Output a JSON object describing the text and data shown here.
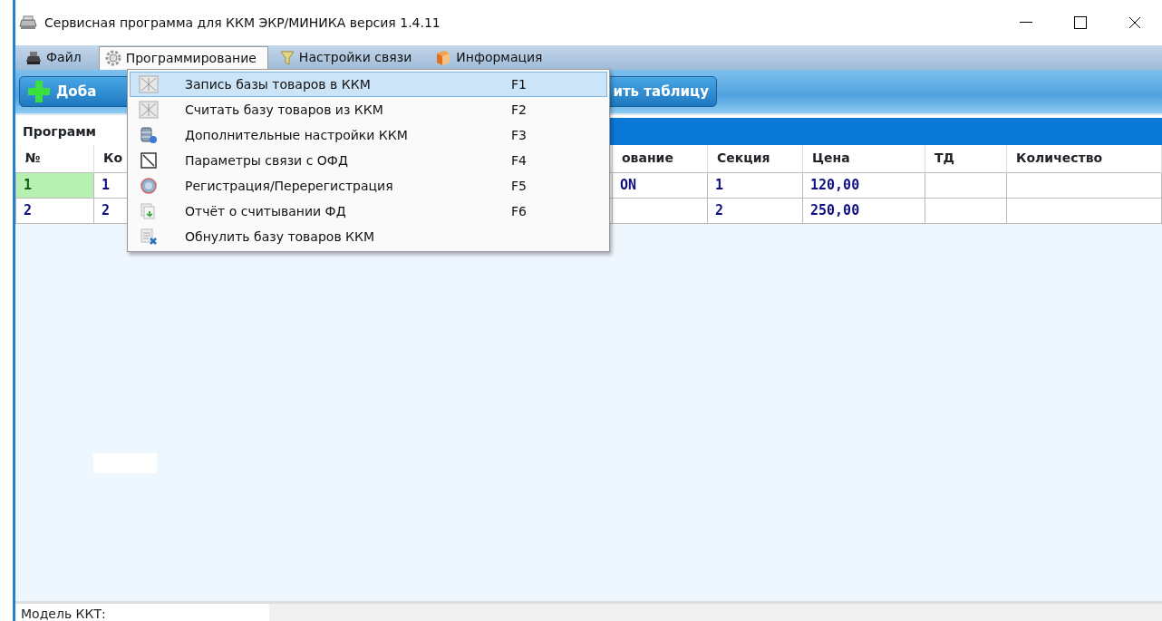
{
  "window": {
    "title": "Сервисная программа для ККМ ЭКР/МИНИКА версия 1.4.11"
  },
  "menu": [
    {
      "label": "Файл",
      "selected": false
    },
    {
      "label": "Программирование",
      "selected": true
    },
    {
      "label": "Настройки связи",
      "selected": false
    },
    {
      "label": "Информация",
      "selected": false
    }
  ],
  "dropdown": {
    "items": [
      {
        "label": "Запись базы товаров в ККМ",
        "shortcut": "F1",
        "selected": true
      },
      {
        "label": "Считать базу товаров из ККМ",
        "shortcut": "F2",
        "selected": false
      },
      {
        "label": "Дополнительные настройки ККМ",
        "shortcut": "F3",
        "selected": false
      },
      {
        "label": "Параметры связи с ОФД",
        "shortcut": "F4",
        "selected": false
      },
      {
        "label": "Регистрация/Перерегистрация",
        "shortcut": "F5",
        "selected": false
      },
      {
        "label": "Отчёт о считывании ФД",
        "shortcut": "F6",
        "selected": false
      },
      {
        "label": "Обнулить базу товаров ККМ",
        "selected": false
      }
    ]
  },
  "toolbar": {
    "buttons": [
      {
        "label": "Доба",
        "kind": "add"
      },
      {
        "label": "ить таблицу",
        "kind": "plain"
      }
    ]
  },
  "panel": {
    "tab": "Программ"
  },
  "table": {
    "columns": [
      "№",
      "Ко",
      "ование",
      "Секция",
      "Цена",
      "ТД",
      "Количество"
    ],
    "rows": [
      {
        "cells": [
          "1",
          "1",
          "ON",
          "1",
          "120,00"
        ],
        "selected": true
      },
      {
        "cells": [
          "2",
          "2",
          null,
          "2",
          "250,00"
        ],
        "selected": false
      }
    ]
  },
  "status_bar": {
    "label": "Модель ККТ:"
  }
}
